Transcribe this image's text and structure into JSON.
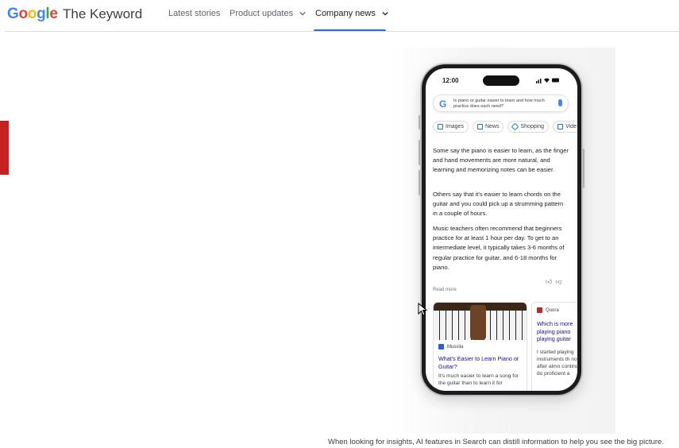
{
  "header": {
    "logo": "Google",
    "title": "The Keyword",
    "nav": [
      {
        "label": "Latest stories"
      },
      {
        "label": "Product updates"
      },
      {
        "label": "Company news"
      }
    ]
  },
  "phone": {
    "time": "12:00",
    "search_query": "Is piano or guitar easier to learn and how much practice does each need?",
    "chips": [
      "Images",
      "News",
      "Shopping",
      "Vide"
    ],
    "paragraphs": [
      "Some say the piano is easier to learn, as the finger and hand movements are more natural, and learning and memorizing notes can be easier.",
      "Others say that it's easier to learn chords on the guitar and you could pick up a strumming pattern in a couple of hours.",
      "Music teachers often recommend that beginners practice for at least 1 hour per day. To get to an intermediate level, it typically takes 3-6 months of regular practice for guitar, and 6-18 months for piano."
    ],
    "read_more": "Read more",
    "card1": {
      "source": "Mussila",
      "title": "What's Easier to Learn Piano or Guitar?",
      "body": "It's much easier to learn a song for the guitar than to learn it for"
    },
    "card2": {
      "source": "Quora",
      "title": "Which is more playing piano playing guitar",
      "body": "I started playing instruments th now, after almo continue to do proficient a"
    }
  },
  "caption": "When looking for insights, AI features in Search can distill information to help you see the big picture.",
  "colors": {
    "accent": "#1a73e8",
    "red_block": "#c5221f",
    "link": "#1a0dab"
  }
}
